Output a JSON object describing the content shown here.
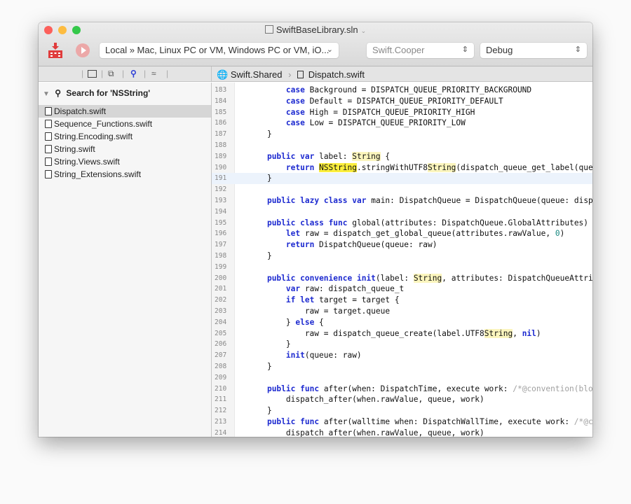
{
  "window": {
    "title": "SwiftBaseLibrary.sln",
    "traffic_lights": [
      "#fc605b",
      "#fdbc40",
      "#34c84a"
    ]
  },
  "toolbar": {
    "build_icon": "build-icon",
    "run_icon": "play-icon",
    "target": "Local » Mac, Linux PC or VM, Windows PC or VM, iO...",
    "scheme": "Swift.Cooper",
    "configuration": "Debug"
  },
  "breadcrumb": {
    "project": "Swift.Shared",
    "file": "Dispatch.swift"
  },
  "sidebar": {
    "search_title": "Search for 'NSString'",
    "files": [
      {
        "name": "Dispatch.swift",
        "selected": true
      },
      {
        "name": "Sequence_Functions.swift"
      },
      {
        "name": "String.Encoding.swift"
      },
      {
        "name": "String.swift"
      },
      {
        "name": "String.Views.swift"
      },
      {
        "name": "String_Extensions.swift"
      }
    ]
  },
  "editor": {
    "current_line": "191",
    "lines": [
      {
        "num": "183",
        "tokens": [
          [
            "",
            "        "
          ],
          [
            "k",
            "case"
          ],
          [
            "",
            " Background = DISPATCH_QUEUE_PRIORITY_BACKGROUND"
          ]
        ]
      },
      {
        "num": "184",
        "tokens": [
          [
            "",
            "        "
          ],
          [
            "k",
            "case"
          ],
          [
            "",
            " Default = DISPATCH_QUEUE_PRIORITY_DEFAULT"
          ]
        ]
      },
      {
        "num": "185",
        "tokens": [
          [
            "",
            "        "
          ],
          [
            "k",
            "case"
          ],
          [
            "",
            " High = DISPATCH_QUEUE_PRIORITY_HIGH"
          ]
        ]
      },
      {
        "num": "186",
        "tokens": [
          [
            "",
            "        "
          ],
          [
            "k",
            "case"
          ],
          [
            "",
            " Low = DISPATCH_QUEUE_PRIORITY_LOW"
          ]
        ]
      },
      {
        "num": "187",
        "tokens": [
          [
            "",
            "    }"
          ]
        ]
      },
      {
        "num": "188",
        "tokens": []
      },
      {
        "num": "189",
        "tokens": [
          [
            "",
            "    "
          ],
          [
            "k",
            "public"
          ],
          [
            "",
            " "
          ],
          [
            "k",
            "var"
          ],
          [
            "",
            " label: "
          ],
          [
            "h",
            "String"
          ],
          [
            "",
            " {"
          ]
        ]
      },
      {
        "num": "190",
        "tokens": [
          [
            "",
            "        "
          ],
          [
            "k",
            "return"
          ],
          [
            "",
            " "
          ],
          [
            "hs",
            "NSString"
          ],
          [
            "",
            ".stringWithUTF8"
          ],
          [
            "h",
            "String"
          ],
          [
            "",
            "(dispatch_queue_get_label(queue))"
          ]
        ]
      },
      {
        "num": "191",
        "tokens": [
          [
            "",
            "    }"
          ]
        ]
      },
      {
        "num": "192",
        "tokens": []
      },
      {
        "num": "193",
        "tokens": [
          [
            "",
            "    "
          ],
          [
            "k",
            "public"
          ],
          [
            "",
            " "
          ],
          [
            "k",
            "lazy"
          ],
          [
            "",
            " "
          ],
          [
            "k",
            "class"
          ],
          [
            "",
            " "
          ],
          [
            "k",
            "var"
          ],
          [
            "",
            " main: DispatchQueue = DispatchQueue(queue: dispatch"
          ]
        ]
      },
      {
        "num": "194",
        "tokens": []
      },
      {
        "num": "195",
        "tokens": [
          [
            "",
            "    "
          ],
          [
            "k",
            "public"
          ],
          [
            "",
            " "
          ],
          [
            "k",
            "class"
          ],
          [
            "",
            " "
          ],
          [
            "k",
            "func"
          ],
          [
            "",
            " global(attributes: DispatchQueue.GlobalAttributes) "
          ]
        ]
      },
      {
        "num": "196",
        "tokens": [
          [
            "",
            "        "
          ],
          [
            "k",
            "let"
          ],
          [
            "",
            " raw = dispatch_get_global_queue(attributes.rawValue, "
          ],
          [
            "n",
            "0"
          ],
          [
            "",
            ")"
          ]
        ]
      },
      {
        "num": "197",
        "tokens": [
          [
            "",
            "        "
          ],
          [
            "k",
            "return"
          ],
          [
            "",
            " DispatchQueue(queue: raw)"
          ]
        ]
      },
      {
        "num": "198",
        "tokens": [
          [
            "",
            "    }"
          ]
        ]
      },
      {
        "num": "199",
        "tokens": []
      },
      {
        "num": "200",
        "tokens": [
          [
            "",
            "    "
          ],
          [
            "k",
            "public"
          ],
          [
            "",
            " "
          ],
          [
            "k",
            "convenience"
          ],
          [
            "",
            " "
          ],
          [
            "k",
            "init"
          ],
          [
            "",
            "(label: "
          ],
          [
            "h",
            "String"
          ],
          [
            "",
            ", attributes: DispatchQueueAttributes"
          ]
        ]
      },
      {
        "num": "201",
        "tokens": [
          [
            "",
            "        "
          ],
          [
            "k",
            "var"
          ],
          [
            "",
            " raw: dispatch_queue_t"
          ]
        ]
      },
      {
        "num": "202",
        "tokens": [
          [
            "",
            "        "
          ],
          [
            "k",
            "if"
          ],
          [
            "",
            " "
          ],
          [
            "k",
            "let"
          ],
          [
            "",
            " target = target {"
          ]
        ]
      },
      {
        "num": "203",
        "tokens": [
          [
            "",
            "            raw = target.queue"
          ]
        ]
      },
      {
        "num": "204",
        "tokens": [
          [
            "",
            "        } "
          ],
          [
            "k",
            "else"
          ],
          [
            "",
            " {"
          ]
        ]
      },
      {
        "num": "205",
        "tokens": [
          [
            "",
            "            raw = dispatch_queue_create(label.UTF8"
          ],
          [
            "h",
            "String"
          ],
          [
            "",
            ", "
          ],
          [
            "k",
            "nil"
          ],
          [
            "",
            ")"
          ]
        ]
      },
      {
        "num": "206",
        "tokens": [
          [
            "",
            "        }"
          ]
        ]
      },
      {
        "num": "207",
        "tokens": [
          [
            "",
            "        "
          ],
          [
            "k",
            "init"
          ],
          [
            "",
            "(queue: raw)"
          ]
        ]
      },
      {
        "num": "208",
        "tokens": [
          [
            "",
            "    }"
          ]
        ]
      },
      {
        "num": "209",
        "tokens": []
      },
      {
        "num": "210",
        "tokens": [
          [
            "",
            "    "
          ],
          [
            "k",
            "public"
          ],
          [
            "",
            " "
          ],
          [
            "k",
            "func"
          ],
          [
            "",
            " after(when: DispatchTime, execute work: "
          ],
          [
            "c",
            "/*@convention(block)"
          ]
        ]
      },
      {
        "num": "211",
        "tokens": [
          [
            "",
            "        dispatch_after(when.rawValue, queue, work)"
          ]
        ]
      },
      {
        "num": "212",
        "tokens": [
          [
            "",
            "    }"
          ]
        ]
      },
      {
        "num": "213",
        "tokens": [
          [
            "",
            "    "
          ],
          [
            "k",
            "public"
          ],
          [
            "",
            " "
          ],
          [
            "k",
            "func"
          ],
          [
            "",
            " after(walltime when: DispatchWallTime, execute work: "
          ],
          [
            "c",
            "/*@conv"
          ]
        ]
      },
      {
        "num": "214",
        "tokens": [
          [
            "",
            "        dispatch_after(when.rawValue, queue, work)"
          ]
        ]
      }
    ]
  }
}
